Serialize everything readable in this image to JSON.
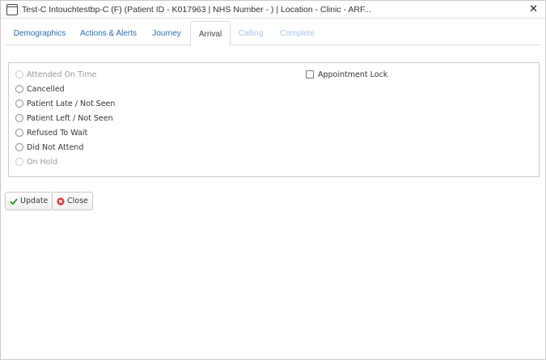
{
  "window": {
    "title": "Test-C Intouchtestbp-C (F) (Patient ID - K017963 | NHS Number - ) | Location - Clinic - ARF..."
  },
  "tabs": [
    {
      "label": "Demographics",
      "state": "normal"
    },
    {
      "label": "Actions & Alerts",
      "state": "normal"
    },
    {
      "label": "Journey",
      "state": "normal"
    },
    {
      "label": "Arrival",
      "state": "active"
    },
    {
      "label": "Calling",
      "state": "disabled"
    },
    {
      "label": "Complete",
      "state": "disabled"
    }
  ],
  "arrival": {
    "options": [
      {
        "label": "Attended On Time",
        "enabled": false,
        "checked": false
      },
      {
        "label": "Cancelled",
        "enabled": true,
        "checked": false
      },
      {
        "label": "Patient Late / Not Seen",
        "enabled": true,
        "checked": false
      },
      {
        "label": "Patient Left / Not Seen",
        "enabled": true,
        "checked": false
      },
      {
        "label": "Refused To Wait",
        "enabled": true,
        "checked": false
      },
      {
        "label": "Did Not Attend",
        "enabled": true,
        "checked": false
      },
      {
        "label": "On Hold",
        "enabled": false,
        "checked": false
      }
    ],
    "appointment_lock": {
      "label": "Appointment Lock",
      "checked": false
    }
  },
  "buttons": {
    "update_label": "Update",
    "close_label": "Close"
  },
  "colors": {
    "tab_link": "#2a6cb0",
    "tab_disabled": "#a9c6e6",
    "update_icon": "#3a9a3a",
    "close_icon": "#d9363e"
  },
  "icons": {
    "window": "window-icon",
    "close": "close-icon",
    "update": "check-icon",
    "close_button": "times-circle-icon"
  }
}
